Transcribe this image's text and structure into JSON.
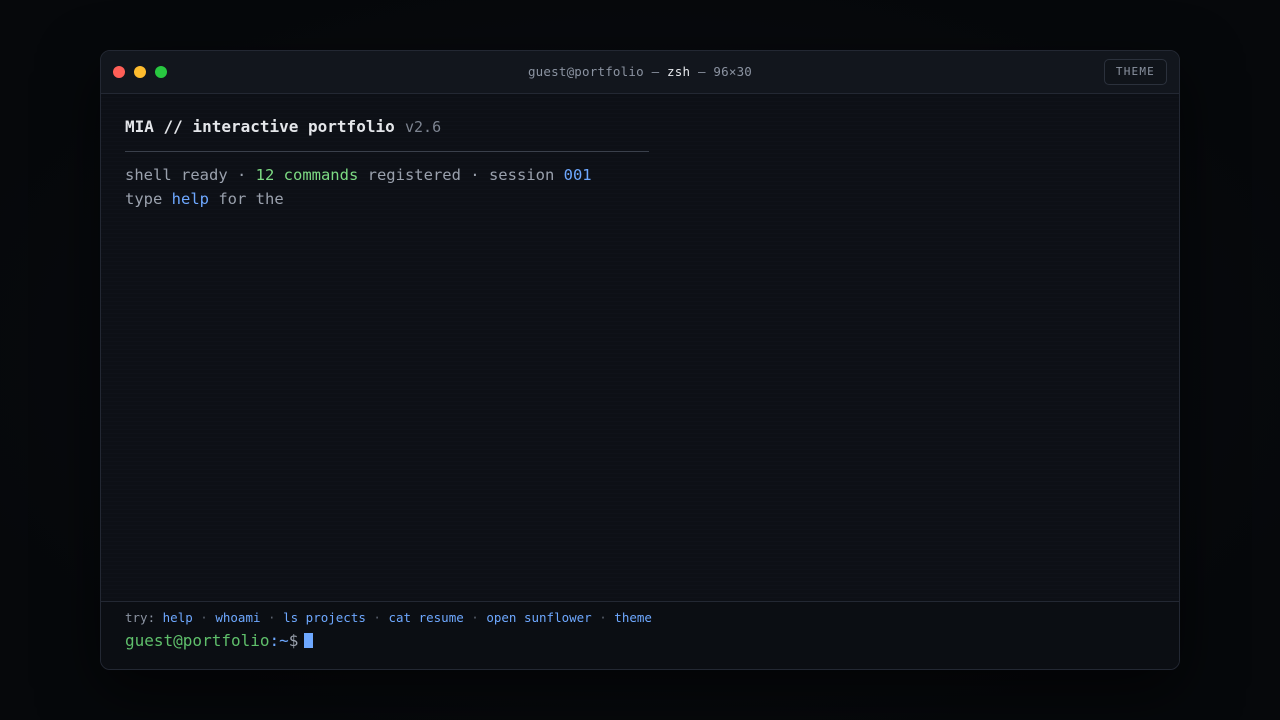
{
  "window": {
    "title_user": "guest@portfolio",
    "title_sep1": " — ",
    "title_shell": "zsh",
    "title_sep2": " — ",
    "title_size": "96×30",
    "theme_button": "THEME"
  },
  "terminal": {
    "heading": "MIA // interactive portfolio",
    "version": "v2.6",
    "line1": {
      "part1": "shell ready · ",
      "count": "12 commands",
      "part2": " registered · session ",
      "session": "001"
    },
    "line2": {
      "part1": "type ",
      "help": "help",
      "part2": " for the"
    }
  },
  "footer": {
    "try_label": "try:",
    "suggestions": [
      "help",
      "whoami",
      "ls projects",
      "cat resume",
      "open sunflower",
      "theme"
    ],
    "separator": "·",
    "prompt_user": "guest@portfolio",
    "prompt_path": ":~",
    "prompt_symbol": "$"
  },
  "colors": {
    "accent_blue": "#6ea8ff",
    "accent_green": "#7ddb83",
    "traffic_red": "#ff5f57",
    "traffic_yellow": "#febc2e",
    "traffic_green": "#28c840"
  }
}
